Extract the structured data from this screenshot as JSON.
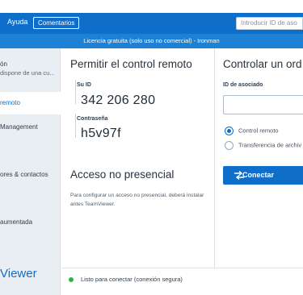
{
  "menubar": {
    "help_label": "Ayuda",
    "feedback_label": "Comentarios",
    "id_search_placeholder": "Introducir ID de aso"
  },
  "license_banner": "Licencia gratuita (solo uso no comercial) - Ironman",
  "sidebar": {
    "items": [
      {
        "label": "ón",
        "sub": "dispone de una cu..."
      },
      {
        "label": "remoto"
      },
      {
        "label": "Management"
      },
      {
        "label": "ores & contactos"
      },
      {
        "label": "aumentada"
      }
    ],
    "brand": "Viewer"
  },
  "allow_panel": {
    "title": "Permitir el control remoto",
    "id_label": "Su ID",
    "id_value": "342 206 280",
    "password_label": "Contraseña",
    "password_value": "h5v97f",
    "unattended_title": "Acceso no presencial",
    "unattended_desc": "Para configurar un acceso no presencial, deberá instalar antes TeamViewer."
  },
  "control_panel": {
    "title": "Controlar un ord",
    "partner_label": "ID de asociado",
    "partner_value": "",
    "options": [
      {
        "label": "Control remoto",
        "checked": true
      },
      {
        "label": "Transferencia de archiv",
        "checked": false
      }
    ],
    "connect_label": "Conectar"
  },
  "status": {
    "text": "Listo para conectar (conexión segura)",
    "color": "#2fb24a"
  },
  "colors": {
    "accent": "#0e6ec9",
    "banner": "#1d82d6",
    "sidebar_bg": "#e9eef3"
  }
}
